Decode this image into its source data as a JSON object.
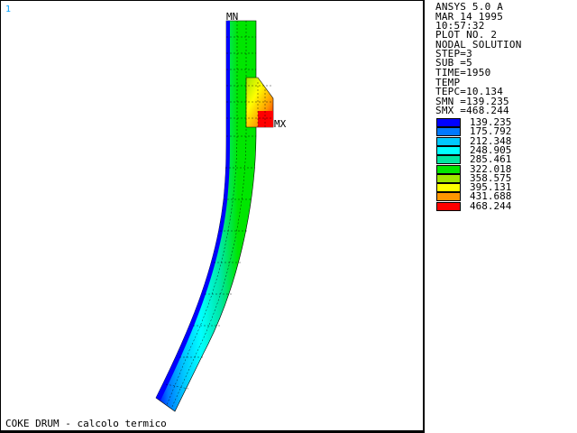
{
  "window": {
    "number": "1"
  },
  "plot": {
    "caption": "COKE DRUM - calcolo termico",
    "min_label": "MN",
    "max_label": "MX"
  },
  "info": {
    "lines": [
      "ANSYS 5.0 A",
      "MAR 14 1995",
      "10:57:32",
      "PLOT NO.   2",
      "NODAL SOLUTION",
      "STEP=3",
      "SUB =5",
      "TIME=1950",
      "TEMP",
      "TEPC=10.134",
      "SMN =139.235",
      "SMX =468.244"
    ]
  },
  "legend": [
    {
      "value": "139.235",
      "color": "#0000ff"
    },
    {
      "value": "175.792",
      "color": "#0078ff"
    },
    {
      "value": "212.348",
      "color": "#00c8ff"
    },
    {
      "value": "248.905",
      "color": "#00ffff"
    },
    {
      "value": "285.461",
      "color": "#00e6a0"
    },
    {
      "value": "322.018",
      "color": "#00e600"
    },
    {
      "value": "358.575",
      "color": "#a0e600"
    },
    {
      "value": "395.131",
      "color": "#ffff00"
    },
    {
      "value": "431.688",
      "color": "#ff9600"
    },
    {
      "value": "468.244",
      "color": "#ff0000"
    }
  ]
}
